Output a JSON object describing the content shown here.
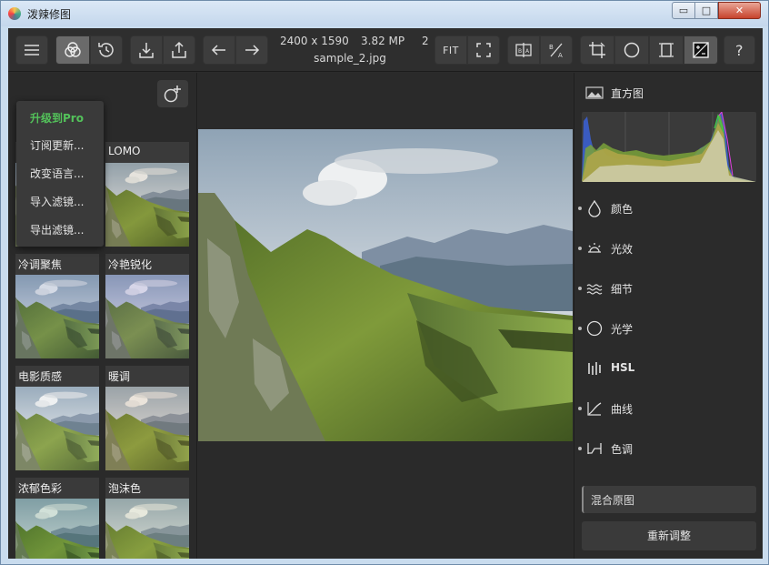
{
  "window": {
    "title": "泼辣修图",
    "minimize_symbol": "▭",
    "maximize_symbol": "□",
    "close_symbol": "✕"
  },
  "toolbar": {
    "image_info": {
      "dimensions": "2400 x 1590",
      "megapixels": "3.82 MP",
      "more": "2",
      "filename": "sample_2.jpg"
    },
    "fit_label": "FIT",
    "help_label": "?",
    "icons": [
      "menu-icon",
      "filters-icon",
      "history-icon",
      "import-icon",
      "export-icon",
      "undo-icon",
      "redo-icon",
      "fullscreen-icon",
      "compare-icon",
      "before-after-icon",
      "crop-icon",
      "circle-icon",
      "square-icon",
      "mask-icon"
    ]
  },
  "menu": {
    "items": [
      {
        "label": "升级到Pro"
      },
      {
        "label": "订阅更新..."
      },
      {
        "label": "改变语言..."
      },
      {
        "label": "导入滤镜..."
      },
      {
        "label": "导出滤镜..."
      }
    ]
  },
  "filters": {
    "items": [
      {
        "label": "LOMO"
      },
      {
        "label": "冷调聚焦"
      },
      {
        "label": "冷艳锐化"
      },
      {
        "label": "电影质感"
      },
      {
        "label": "暖调"
      },
      {
        "label": "浓郁色彩"
      },
      {
        "label": "泡沫色"
      }
    ]
  },
  "right_panel": {
    "histogram_label": "直方图",
    "adjustments": [
      {
        "label": "颜色",
        "icon": "drop-icon"
      },
      {
        "label": "光效",
        "icon": "sunrise-icon"
      },
      {
        "label": "细节",
        "icon": "waves-icon"
      },
      {
        "label": "光学",
        "icon": "lens-icon"
      },
      {
        "label": "HSL",
        "icon": "hsl-bars-icon"
      },
      {
        "label": "曲线",
        "icon": "curve-icon"
      },
      {
        "label": "色调",
        "icon": "tone-icon"
      }
    ],
    "blend_label": "混合原图",
    "reset_label": "重新调整"
  },
  "colors": {
    "accent_pro": "#53c25a",
    "panel_bg": "#2b2b2b",
    "button_bg": "#3d3d3d"
  }
}
